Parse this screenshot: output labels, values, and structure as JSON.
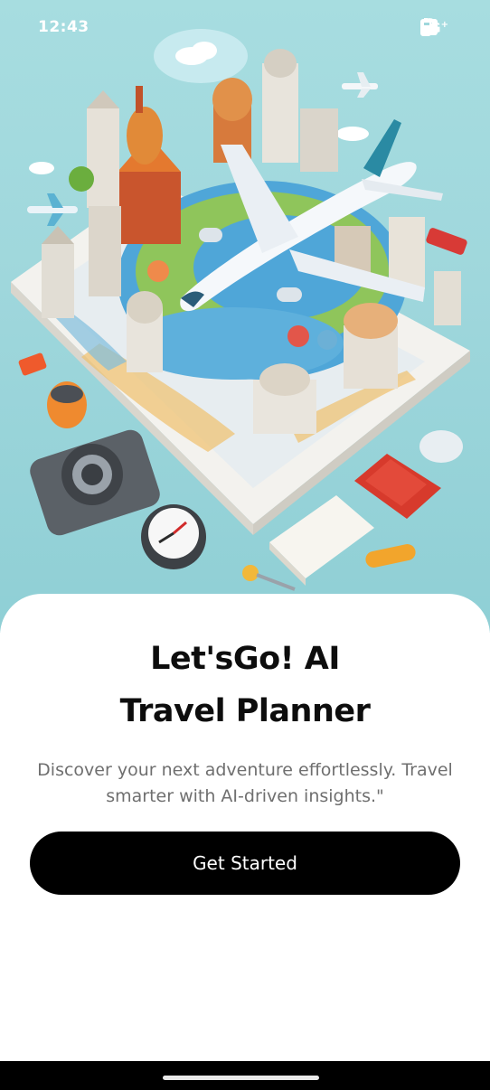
{
  "status_bar": {
    "time": "12:43",
    "network": "5G",
    "network_suffix": "+"
  },
  "hero": {
    "image": "travel-illustration-3d-map-airplane-landmarks"
  },
  "content": {
    "title_line1": "Let'sGo! AI",
    "title_line2": "Travel Planner",
    "subtitle_line1": "Discover your next adventure effortlessly. Travel",
    "subtitle_line2": "smarter with AI-driven insights.\"",
    "cta_label": "Get Started"
  },
  "colors": {
    "hero_bg": "#9fd7dc",
    "button_bg": "#000000",
    "button_text": "#ffffff",
    "title": "#0d0d0d",
    "subtitle": "#6f6f6f"
  }
}
